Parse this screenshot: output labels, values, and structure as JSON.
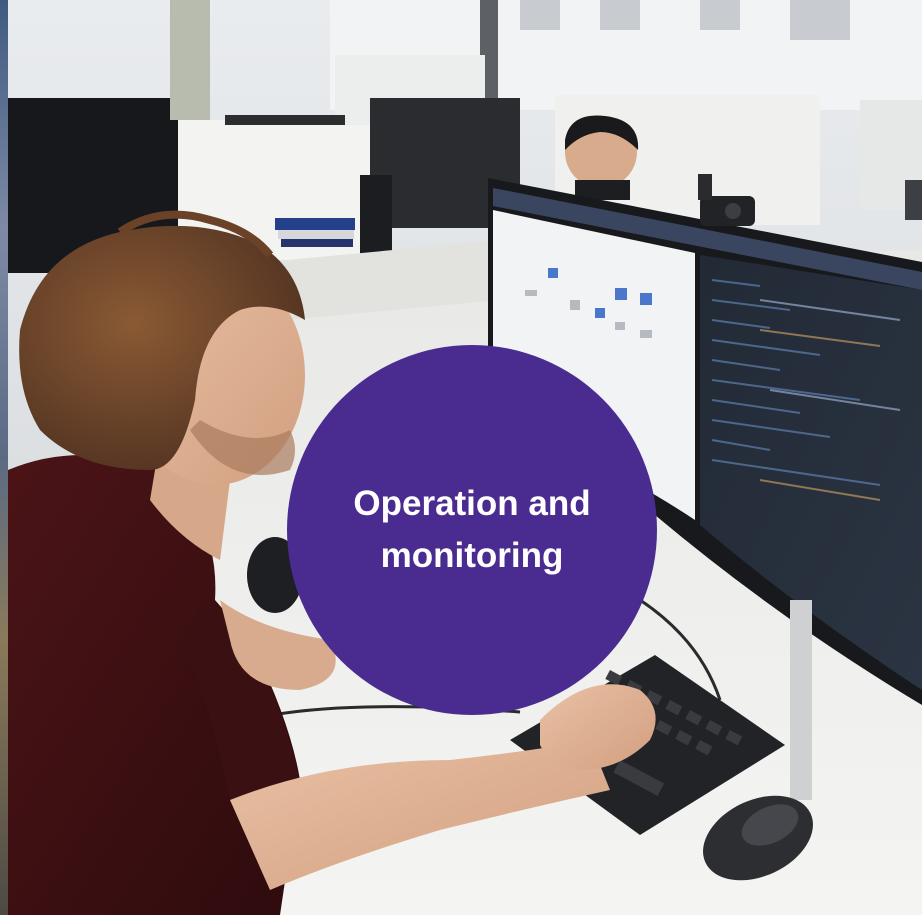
{
  "overlay": {
    "label": "Operation and monitoring",
    "color": "#4a2c91",
    "text_color": "#ffffff"
  },
  "photo": {
    "description_icon": "office-photo"
  }
}
